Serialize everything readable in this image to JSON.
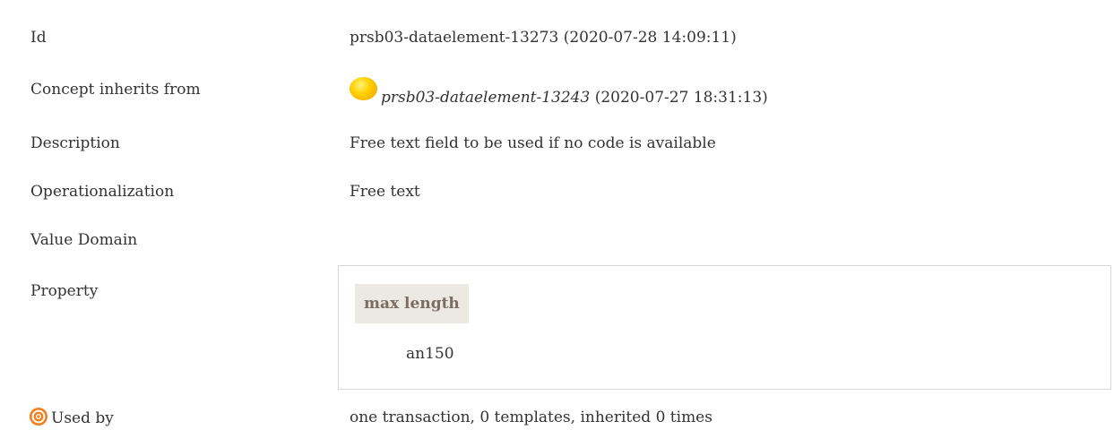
{
  "rows": {
    "id": {
      "label": "Id",
      "value": "prsb03-dataelement-13273 (2020-07-28 14:09:11)"
    },
    "inherits": {
      "label": "Concept inherits from",
      "link_text": "prsb03-dataelement-13243",
      "date_text": " (2020-07-27 18:31:13)",
      "icon": "yellow-orb-icon"
    },
    "description": {
      "label": "Description",
      "value": "Free text field to be used if no code is available"
    },
    "operationalization": {
      "label": "Operationalization",
      "value": "Free text"
    },
    "value_domain": {
      "label": "Value Domain"
    },
    "property": {
      "label": "Property",
      "name": "max length",
      "value": "an150"
    },
    "used_by": {
      "label": "Used by",
      "icon": "target-icon",
      "value": "one transaction, 0 templates, inherited 0 times"
    }
  },
  "colors": {
    "text": "#333333",
    "property_header_bg": "#ece9e3",
    "property_header_text": "#7a6e62",
    "target_icon": "#f07f1d",
    "orb": "#ffd100"
  }
}
